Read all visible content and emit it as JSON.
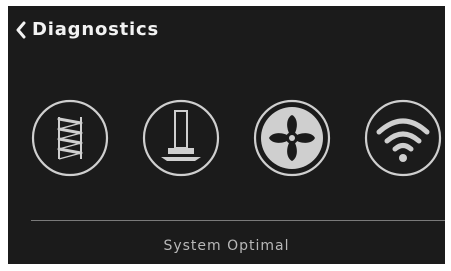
{
  "header": {
    "title": "Diagnostics",
    "back_icon": "chevron-left-icon"
  },
  "diagnostics": {
    "items": [
      {
        "icon": "spring-icon"
      },
      {
        "icon": "piston-icon"
      },
      {
        "icon": "fan-icon"
      },
      {
        "icon": "wifi-icon"
      }
    ]
  },
  "status": {
    "text": "System Optimal"
  },
  "colors": {
    "background": "#1b1b1b",
    "icon_stroke": "#cfcfcf",
    "title_text": "#f2f2f2",
    "status_text": "#b8b8b8",
    "divider": "#7a7a7a"
  }
}
